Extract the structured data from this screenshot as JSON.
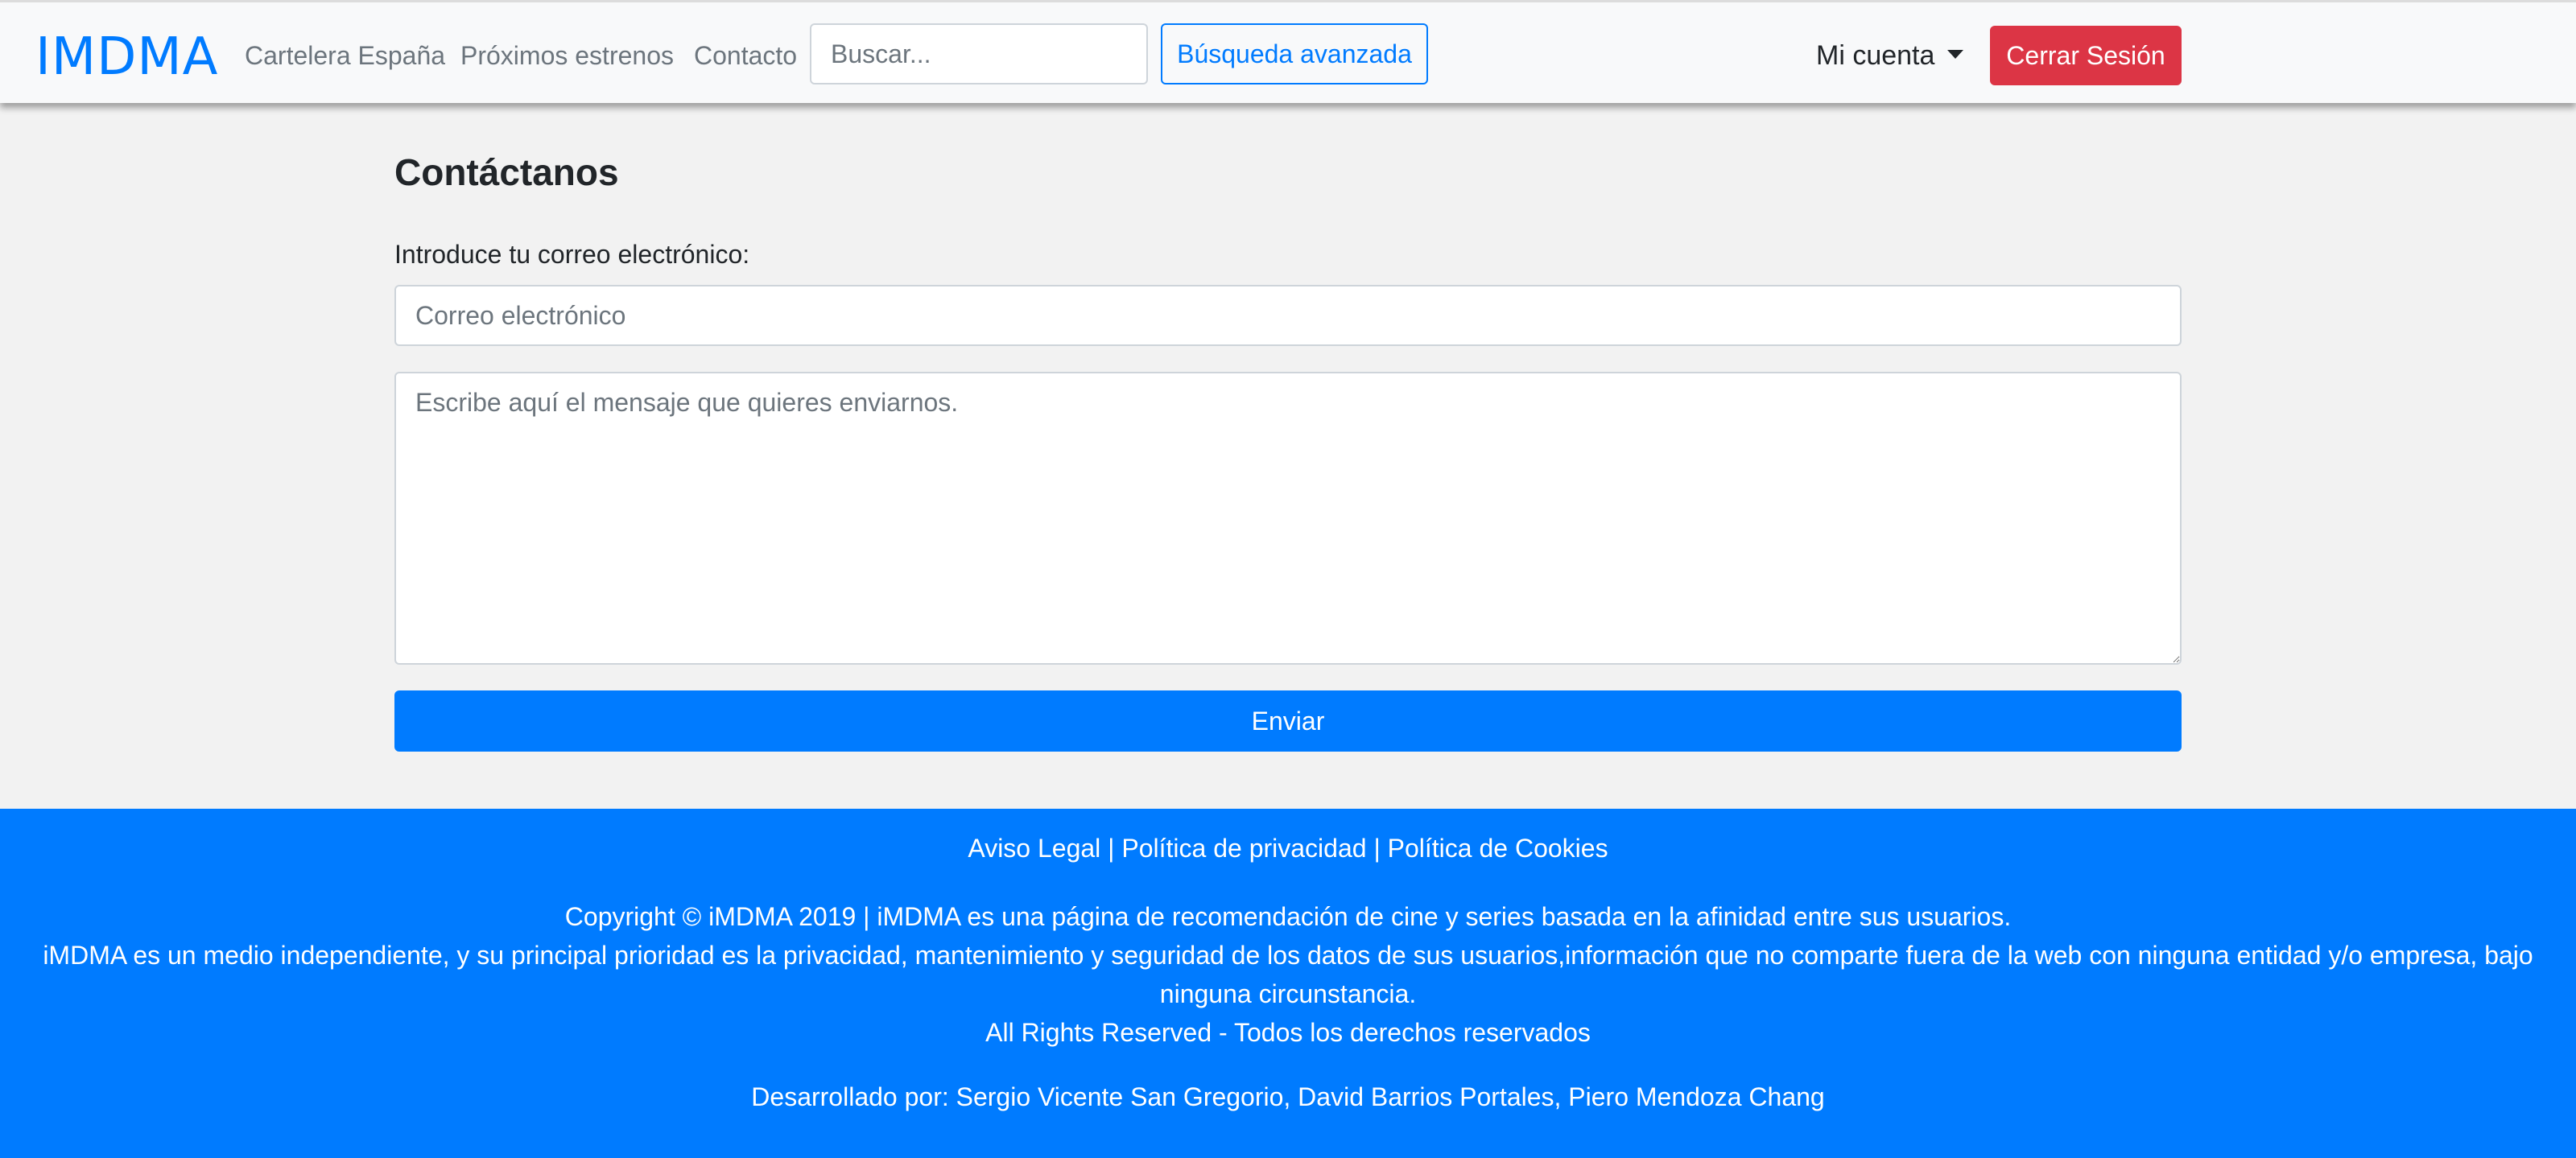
{
  "navbar": {
    "brand": "IMDMA",
    "links": [
      "Cartelera España",
      "Próximos estrenos",
      "Contacto"
    ],
    "search_placeholder": "Buscar...",
    "advanced_search_label": "Búsqueda avanzada",
    "account_label": "Mi cuenta",
    "logout_label": "Cerrar Sesión"
  },
  "main": {
    "title": "Contáctanos",
    "email_label": "Introduce tu correo electrónico:",
    "email_placeholder": "Correo electrónico",
    "message_placeholder": "Escribe aquí el mensaje que quieres enviarnos.",
    "submit_label": "Enviar"
  },
  "footer": {
    "links": [
      "Aviso Legal",
      "Política de privacidad",
      "Política de Cookies"
    ],
    "separator": "|",
    "copyright": "Copyright © iMDMA 2019 | iMDMA es una página de recomendación de cine y series basada en la afinidad entre sus usuarios.",
    "independent_line1": "iMDMA es un medio independiente, y su principal prioridad es la privacidad, mantenimiento y seguridad de los datos de sus usuarios,información que no comparte fuera de la web con ninguna entidad y/o empresa, bajo",
    "independent_line2": "ninguna circunstancia.",
    "rights": "All Rights Reserved - Todos los derechos reservados",
    "developers": "Desarrollado por: Sergio Vicente San Gregorio, David Barrios Portales, Piero Mendoza Chang"
  },
  "colors": {
    "primary": "#007bff",
    "danger": "#dc3545",
    "navbar_bg": "#f8f9fa",
    "page_bg": "#f2f2f2"
  }
}
